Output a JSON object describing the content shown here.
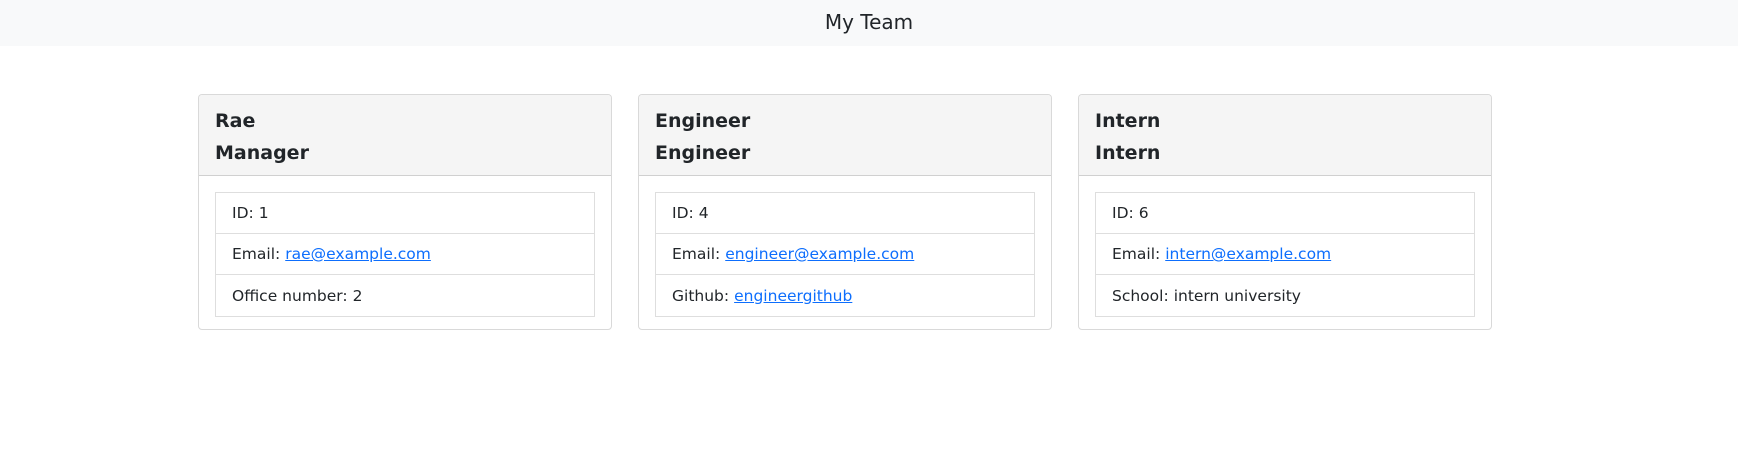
{
  "header": {
    "title": "My Team"
  },
  "cards": [
    {
      "name": "Rae",
      "role": "Manager",
      "id_label": "ID:",
      "id": "1",
      "email_label": "Email:",
      "email": "rae@example.com",
      "extra_label": "Office number:",
      "extra_value": "2"
    },
    {
      "name": "Engineer",
      "role": "Engineer",
      "id_label": "ID:",
      "id": "4",
      "email_label": "Email:",
      "email": "engineer@example.com",
      "extra_label": "Github:",
      "extra_value": "engineergithub"
    },
    {
      "name": "Intern",
      "role": "Intern",
      "id_label": "ID:",
      "id": "6",
      "email_label": "Email:",
      "email": "intern@example.com",
      "extra_label": "School:",
      "extra_value": "intern university"
    }
  ],
  "colors": {
    "link": "#0d6efd",
    "header_bg": "#f8f9fa",
    "card_header_bg": "#f5f5f5"
  }
}
